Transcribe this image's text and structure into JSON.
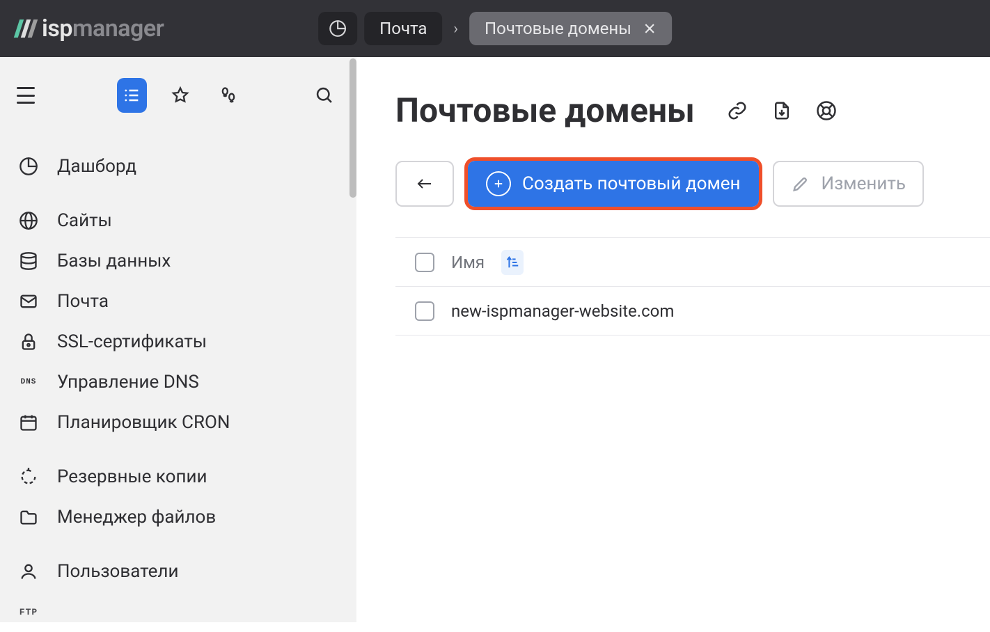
{
  "breadcrumb": {
    "parent": "Почта",
    "current": "Почтовые домены"
  },
  "sidebar": {
    "items": [
      {
        "label": "Дашборд"
      },
      {
        "label": "Сайты"
      },
      {
        "label": "Базы данных"
      },
      {
        "label": "Почта"
      },
      {
        "label": "SSL-сертификаты"
      },
      {
        "label": "Управление DNS"
      },
      {
        "label": "Планировщик CRON"
      },
      {
        "label": "Резервные копии"
      },
      {
        "label": "Менеджер файлов"
      },
      {
        "label": "Пользователи"
      }
    ]
  },
  "page": {
    "title": "Почтовые домены"
  },
  "toolbar": {
    "create_label": "Создать почтовый домен",
    "edit_label": "Изменить"
  },
  "table": {
    "col_name": "Имя",
    "rows": [
      {
        "name": "new-ispmanager-website.com"
      }
    ]
  }
}
